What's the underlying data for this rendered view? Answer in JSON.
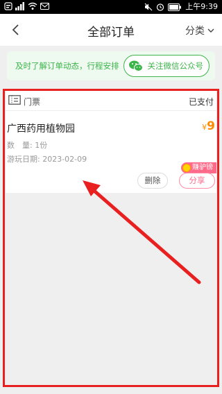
{
  "status_bar": {
    "time": "上午9:39",
    "colors": {
      "bg": "#000000",
      "fg": "#ffffff"
    }
  },
  "nav": {
    "title": "全部订单",
    "filter_label": "分类"
  },
  "promo": {
    "text": "及时了解订单动态，行程安排",
    "button_label": "关注微信公众号"
  },
  "order": {
    "type_label": "门票",
    "status": "已支付",
    "name": "广西药用植物园",
    "price_symbol": "¥",
    "price": "9",
    "quantity": "数　量: 1份",
    "visit_date": "游玩日期: 2023-02-09",
    "earn_badge": "赚驴镑",
    "delete_label": "删除",
    "share_label": "分享"
  },
  "annotation": {
    "highlight_color": "#e82020",
    "arrow_color": "#e82020"
  }
}
